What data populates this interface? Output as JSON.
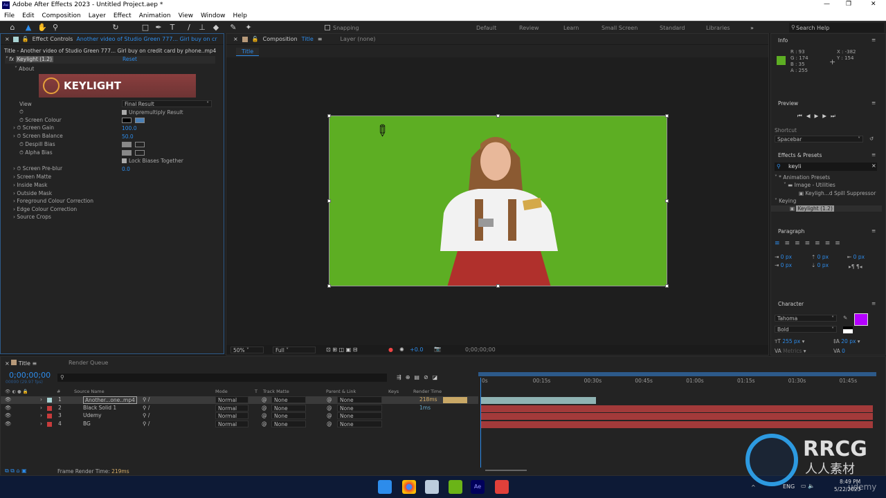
{
  "app": {
    "title": "Adobe After Effects 2023 - Untitled Project.aep *",
    "logo": "Ae"
  },
  "menu": [
    "File",
    "Edit",
    "Composition",
    "Layer",
    "Effect",
    "Animation",
    "View",
    "Window",
    "Help"
  ],
  "toolbar": {
    "snapping": "Snapping",
    "workspaces": [
      "Default",
      "Review",
      "Learn",
      "Small Screen",
      "Standard",
      "Libraries"
    ],
    "search_placeholder": "Search Help"
  },
  "effect_controls": {
    "tab_label": "Effect Controls",
    "tab_source": "Another video of Studio Green 777... Girl buy on cr",
    "subtitle": "Title - Another video of Studio Green 777... Girl buy on credit card by phone..mp4",
    "effect_name": "Keylight (1.2)",
    "reset": "Reset",
    "about": "About",
    "banner": "KEYLIGHT",
    "view_label": "View",
    "view_value": "Final Result",
    "unpremultiply": "Unpremultiply Result",
    "screen_colour": "Screen Colour",
    "screen_gain": "Screen Gain",
    "screen_gain_value": "100.0",
    "screen_balance": "Screen Balance",
    "screen_balance_value": "50.0",
    "despill_bias": "Despill Bias",
    "alpha_bias": "Alpha Bias",
    "lock_biases": "Lock Biases Together",
    "screen_preblur": "Screen Pre-blur",
    "screen_preblur_value": "0.0",
    "groups": [
      "Screen Matte",
      "Inside Mask",
      "Outside Mask",
      "Foreground Colour Correction",
      "Edge Colour Correction",
      "Source Crops"
    ]
  },
  "composition": {
    "tab_label": "Composition",
    "tab_name": "Title",
    "layer_tab": "Layer (none)",
    "sub_tab": "Title",
    "zoom": "50%",
    "resolution": "Full",
    "exposure": "+0.0",
    "timecode": "0;00;00;00",
    "bg_color": "#5dae23"
  },
  "info": {
    "title": "Info",
    "r": "R : 93",
    "g": "G : 174",
    "b": "B : 35",
    "a": "A : 255",
    "x": "X : -382",
    "y": "Y : 154",
    "swatch": "#5dae23"
  },
  "preview": {
    "title": "Preview",
    "shortcut_label": "Shortcut",
    "shortcut_value": "Spacebar"
  },
  "effects_presets": {
    "title": "Effects & Presets",
    "search": "keyli",
    "tree": [
      "* Animation Presets",
      "Image - Utilities",
      "Keyligh...d Spill Suppressor",
      "Keying",
      "Keylight (1.2)"
    ]
  },
  "paragraph": {
    "title": "Paragraph",
    "indent": [
      "0 px",
      "0 px",
      "0 px",
      "0 px",
      "0 px"
    ]
  },
  "character": {
    "title": "Character",
    "font": "Tahoma",
    "style": "Bold",
    "size": "255 px",
    "leading": "20 px",
    "kerning": "Metrics",
    "tracking": "0",
    "fill_color": "#b400ff"
  },
  "timeline": {
    "tab_label": "Title",
    "render_queue": "Render Queue",
    "timecode": "0;00;00;00",
    "fps": "00000 (29.97 fps)",
    "columns": [
      "#",
      "Source Name",
      "Mode",
      "T",
      "Track Matte",
      "Parent & Link",
      "Keys",
      "Render Time"
    ],
    "ruler": [
      "0s",
      "00:15s",
      "00:30s",
      "00:45s",
      "01:00s",
      "01:15s",
      "01:30s",
      "01:45s"
    ],
    "layers": [
      {
        "num": "1",
        "name": "Another...one..mp4",
        "mode": "Normal",
        "matte": "None",
        "parent": "None",
        "render": "218ms",
        "label": "#a9d4d4"
      },
      {
        "num": "2",
        "name": "Black Solid 1",
        "mode": "Normal",
        "matte": "None",
        "parent": "None",
        "render": "1ms",
        "label": "#c83c3c"
      },
      {
        "num": "3",
        "name": "Udemy",
        "mode": "Normal",
        "matte": "None",
        "parent": "None",
        "render": "",
        "label": "#c83c3c"
      },
      {
        "num": "4",
        "name": "BG",
        "mode": "Normal",
        "matte": "None",
        "parent": "None",
        "render": "",
        "label": "#c83c3c"
      }
    ],
    "frame_render_label": "Frame Render Time:",
    "frame_render_value": "219ms"
  },
  "taskbar": {
    "lang": "ENG",
    "time": "8:49 PM",
    "date": "5/22/2023"
  },
  "watermark": {
    "text": "RRCG",
    "sub": "人人素材",
    "udemy": "udemy"
  }
}
